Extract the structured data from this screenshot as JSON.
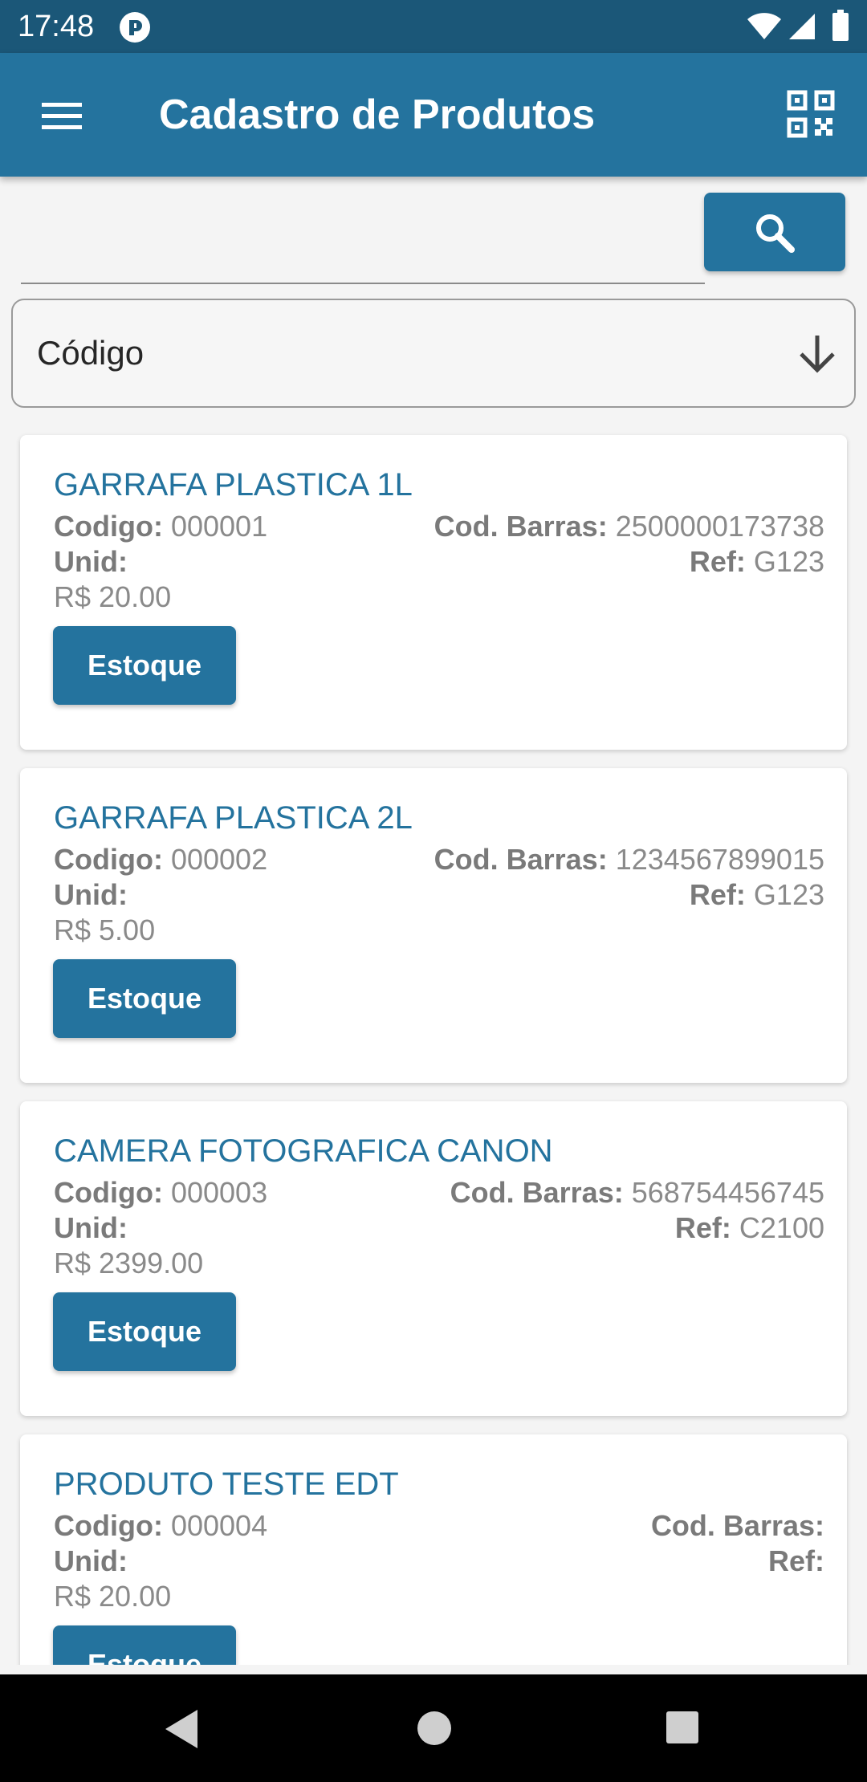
{
  "status_bar": {
    "time": "17:48",
    "app_icon": "notification-app-icon",
    "wifi_icon": "wifi-icon",
    "signal_icon": "signal-icon",
    "battery_icon": "battery-icon"
  },
  "app_bar": {
    "title": "Cadastro de Produtos",
    "menu_icon": "hamburger-menu-icon",
    "qr_icon": "qr-code-icon",
    "color": "#24739e"
  },
  "search": {
    "value": "",
    "placeholder": "",
    "button_icon": "search-icon"
  },
  "filter_select": {
    "value": "Código",
    "arrow_icon": "arrow-down-icon"
  },
  "labels": {
    "codigo": "Codigo:",
    "cod_barras": "Cod. Barras:",
    "unid": "Unid:",
    "ref": "Ref:",
    "estoque": "Estoque"
  },
  "products": [
    {
      "name": "GARRAFA PLASTICA 1L",
      "codigo": "000001",
      "cod_barras": "2500000173738",
      "unid": "",
      "ref": "G123",
      "price": "R$ 20.00"
    },
    {
      "name": "GARRAFA PLASTICA 2L",
      "codigo": "000002",
      "cod_barras": "1234567899015",
      "unid": "",
      "ref": "G123",
      "price": "R$ 5.00"
    },
    {
      "name": "CAMERA FOTOGRAFICA CANON",
      "codigo": "000003",
      "cod_barras": "568754456745",
      "unid": "",
      "ref": "C2100",
      "price": "R$ 2399.00"
    },
    {
      "name": "PRODUTO TESTE EDT",
      "codigo": "000004",
      "cod_barras": "",
      "unid": "",
      "ref": "",
      "price": "R$ 20.00"
    }
  ],
  "nav_bar": {
    "back_icon": "back-triangle-icon",
    "home_icon": "home-circle-icon",
    "recent_icon": "recent-apps-square-icon"
  }
}
